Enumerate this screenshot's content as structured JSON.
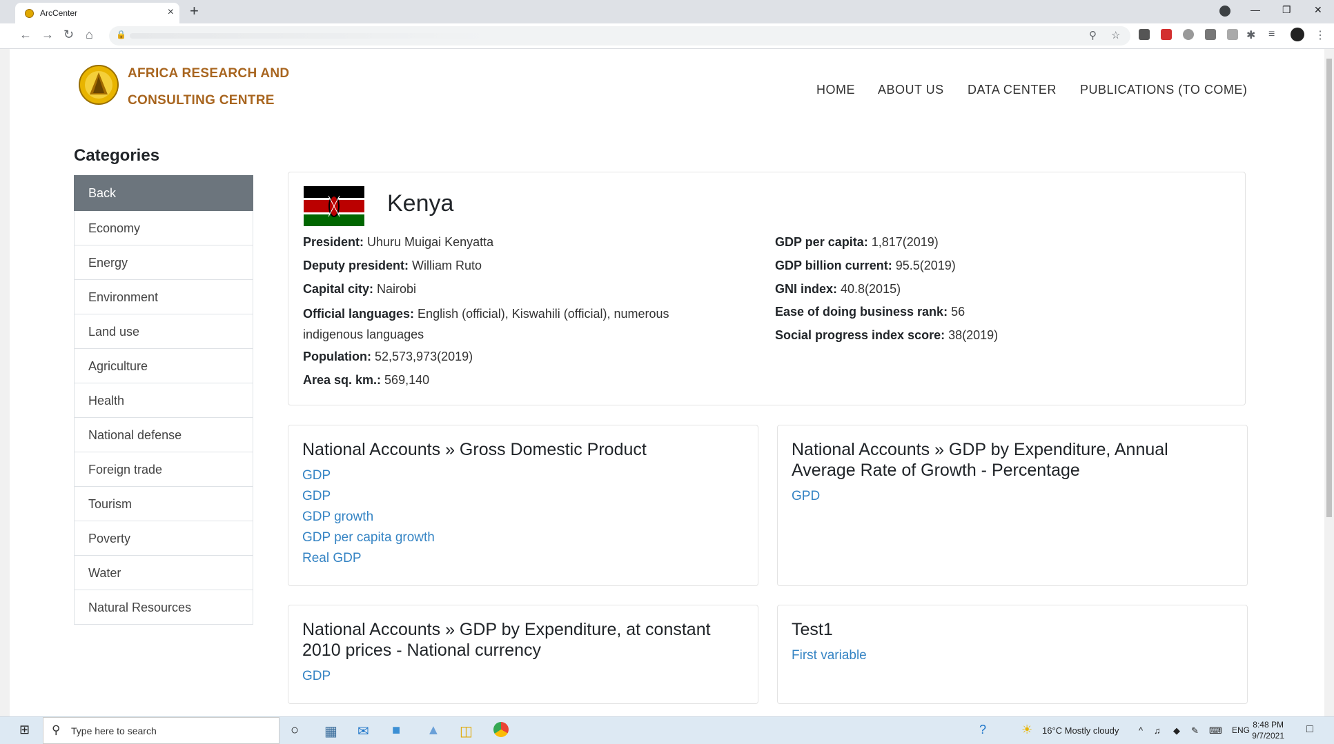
{
  "browser": {
    "tab_title": "ArcCenter",
    "tab_close": "×",
    "new_tab": "+",
    "minimize": "—",
    "restore": "❐",
    "close": "✕"
  },
  "header": {
    "brand_line1": "AFRICA RESEARCH AND",
    "brand_line2": "CONSULTING CENTRE",
    "logo_text": "ArcCentre",
    "nav": [
      "HOME",
      "ABOUT US",
      "DATA CENTER",
      "PUBLICATIONS (TO COME)"
    ]
  },
  "sidebar": {
    "title": "Categories",
    "items": [
      "Back",
      "Economy",
      "Energy",
      "Environment",
      "Land use",
      "Agriculture",
      "Health",
      "National defense",
      "Foreign trade",
      "Tourism",
      "Poverty",
      "Water",
      "Natural Resources"
    ]
  },
  "country": {
    "name": "Kenya",
    "left": [
      {
        "label": "President:",
        "value": " Uhuru Muigai Kenyatta"
      },
      {
        "label": "Deputy president:",
        "value": " William Ruto"
      },
      {
        "label": "Capital city:",
        "value": " Nairobi"
      },
      {
        "label": "Official languages:",
        "value": " English (official), Kiswahili (official), numerous indigenous languages"
      },
      {
        "label": "Population:",
        "value": " 52,573,973(2019)"
      },
      {
        "label": "Area sq. km.:",
        "value": " 569,140"
      }
    ],
    "right": [
      {
        "label": "GDP per capita:",
        "value": " 1,817(2019)"
      },
      {
        "label": "GDP billion current:",
        "value": " 95.5(2019)"
      },
      {
        "label": "GNI index:",
        "value": " 40.8(2015)"
      },
      {
        "label": "Ease of doing business rank:",
        "value": " 56"
      },
      {
        "label": "Social progress index score:",
        "value": " 38(2019)"
      }
    ]
  },
  "cards": [
    {
      "title": "National Accounts » Gross Domestic Product",
      "links": [
        "GDP",
        "GDP",
        "GDP growth",
        "GDP per capita growth",
        "Real GDP"
      ]
    },
    {
      "title": "National Accounts » GDP by Expenditure, Annual Average Rate of Growth - Percentage",
      "links": [
        "GPD"
      ]
    },
    {
      "title": "National Accounts » GDP by Expenditure, at constant 2010 prices - National currency",
      "links": [
        "GDP"
      ]
    },
    {
      "title": "Test1",
      "links": [
        "First variable"
      ]
    }
  ],
  "taskbar": {
    "search_placeholder": "Type here to search",
    "weather": "16°C  Mostly cloudy",
    "lang": "ENG",
    "time": "8:48 PM",
    "date": "9/7/2021"
  },
  "colors": {
    "brand": "#a8651f",
    "link": "#3584c4",
    "active": "#6c757d"
  }
}
